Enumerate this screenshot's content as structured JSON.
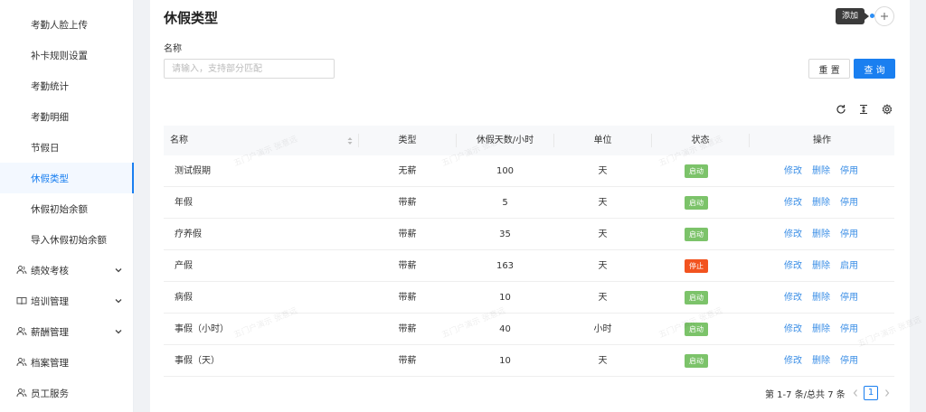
{
  "sidebar": {
    "sub_items": [
      {
        "label": "考勤人脸上传"
      },
      {
        "label": "补卡规则设置"
      },
      {
        "label": "考勤统计"
      },
      {
        "label": "考勤明细"
      },
      {
        "label": "节假日"
      },
      {
        "label": "休假类型",
        "active": true
      },
      {
        "label": "休假初始余额"
      },
      {
        "label": "导入休假初始余额"
      }
    ],
    "groups": [
      {
        "label": "绩效考核",
        "icon": "people-icon",
        "expandable": true
      },
      {
        "label": "培训管理",
        "icon": "book-icon",
        "expandable": true
      },
      {
        "label": "薪酬管理",
        "icon": "people-icon",
        "expandable": true
      },
      {
        "label": "档案管理",
        "icon": "people-icon",
        "expandable": false
      },
      {
        "label": "员工服务",
        "icon": "people-icon",
        "expandable": false
      }
    ]
  },
  "page": {
    "title": "休假类型",
    "add_tooltip": "添加"
  },
  "filter": {
    "name_label": "名称",
    "name_placeholder": "请输入，支持部分匹配",
    "reset_label": "重 置",
    "query_label": "查 询"
  },
  "table": {
    "columns": {
      "name": "名称",
      "type": "类型",
      "days": "休假天数/小时",
      "unit": "单位",
      "status": "状态",
      "actions": "操作"
    },
    "rows": [
      {
        "name": "测试假期",
        "type": "无薪",
        "days": "100",
        "unit": "天",
        "status": "启动",
        "status_on": true,
        "edit": "修改",
        "delete": "删除",
        "toggle": "停用"
      },
      {
        "name": "年假",
        "type": "带薪",
        "days": "5",
        "unit": "天",
        "status": "启动",
        "status_on": true,
        "edit": "修改",
        "delete": "删除",
        "toggle": "停用"
      },
      {
        "name": "疗养假",
        "type": "带薪",
        "days": "35",
        "unit": "天",
        "status": "启动",
        "status_on": true,
        "edit": "修改",
        "delete": "删除",
        "toggle": "停用"
      },
      {
        "name": "产假",
        "type": "带薪",
        "days": "163",
        "unit": "天",
        "status": "停止",
        "status_on": false,
        "edit": "修改",
        "delete": "删除",
        "toggle": "启用"
      },
      {
        "name": "病假",
        "type": "带薪",
        "days": "10",
        "unit": "天",
        "status": "启动",
        "status_on": true,
        "edit": "修改",
        "delete": "删除",
        "toggle": "停用"
      },
      {
        "name": "事假（小时）",
        "type": "带薪",
        "days": "40",
        "unit": "小时",
        "status": "启动",
        "status_on": true,
        "edit": "修改",
        "delete": "删除",
        "toggle": "停用"
      },
      {
        "name": "事假（天）",
        "type": "带薪",
        "days": "10",
        "unit": "天",
        "status": "启动",
        "status_on": true,
        "edit": "修改",
        "delete": "删除",
        "toggle": "停用"
      }
    ]
  },
  "pagination": {
    "summary": "第 1-7 条/总共 7 条",
    "current_page": "1"
  },
  "watermark": "五门户演示 张意远",
  "colors": {
    "accent": "#1a7ff0",
    "status_on": "#7cc36a",
    "status_off": "#f2531f",
    "link": "#3a8ee6"
  }
}
